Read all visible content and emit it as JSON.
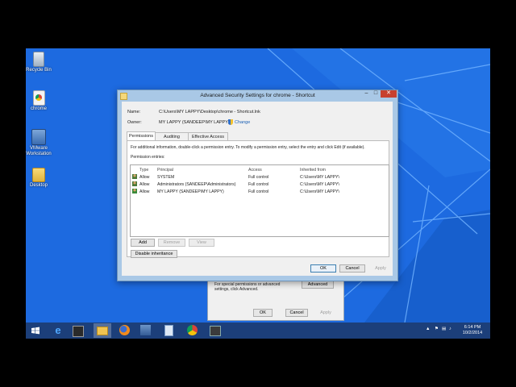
{
  "desktop": {
    "icons": [
      {
        "label": "Recycle Bin",
        "icon": "recycle-bin-icon"
      },
      {
        "label": "chrome",
        "icon": "shortcut-icon"
      },
      {
        "label": "VMware Workstation",
        "icon": "vmware-icon"
      },
      {
        "label": "Desktop",
        "icon": "folder-icon"
      }
    ]
  },
  "dialog": {
    "title": "Advanced Security Settings for chrome - Shortcut",
    "name_label": "Name:",
    "name_value": "C:\\Users\\MY LAPPY\\Desktop\\chrome - Shortcut.lnk",
    "owner_label": "Owner:",
    "owner_value": "MY LAPPY (SANDEEP\\MY LAPPY)",
    "change_link": "Change",
    "tabs": [
      "Permissions",
      "Auditing",
      "Effective Access"
    ],
    "info_text": "For additional information, double-click a permission entry. To modify a permission entry, select the entry and click Edit (if available).",
    "entries_label": "Permission entries:",
    "columns": [
      "Type",
      "Principal",
      "Access",
      "Inherited from"
    ],
    "rows": [
      {
        "type": "Allow",
        "principal": "SYSTEM",
        "access": "Full control",
        "inherited": "C:\\Users\\MY LAPPY\\"
      },
      {
        "type": "Allow",
        "principal": "Administrators (SANDEEP\\Administrators)",
        "access": "Full control",
        "inherited": "C:\\Users\\MY LAPPY\\"
      },
      {
        "type": "Allow",
        "principal": "MY LAPPY (SANDEEP\\MY LAPPY)",
        "access": "Full control",
        "inherited": "C:\\Users\\MY LAPPY\\"
      }
    ],
    "add_button": "Add",
    "remove_button": "Remove",
    "view_button": "View",
    "disable_inheritance_button": "Disable inheritance",
    "ok_button": "OK",
    "cancel_button": "Cancel",
    "apply_button": "Apply"
  },
  "background_dialog": {
    "text": "For special permissions or advanced settings, click Advanced.",
    "advanced_button": "Advanced",
    "ok_button": "OK",
    "cancel_button": "Cancel",
    "apply_button": "Apply"
  },
  "taskbar": {
    "apps": [
      "ie-icon",
      "terminal-icon",
      "file-explorer-icon",
      "firefox-icon",
      "app-icon",
      "notepad-icon",
      "chrome-icon",
      "camtasia-icon"
    ],
    "time": "6:14 PM",
    "date": "10/2/2014"
  },
  "colors": {
    "desktop": "#1a67d8",
    "taskbar": "#1c3f7a",
    "titlebar": "#a9c8e6",
    "close": "#c7402f"
  }
}
